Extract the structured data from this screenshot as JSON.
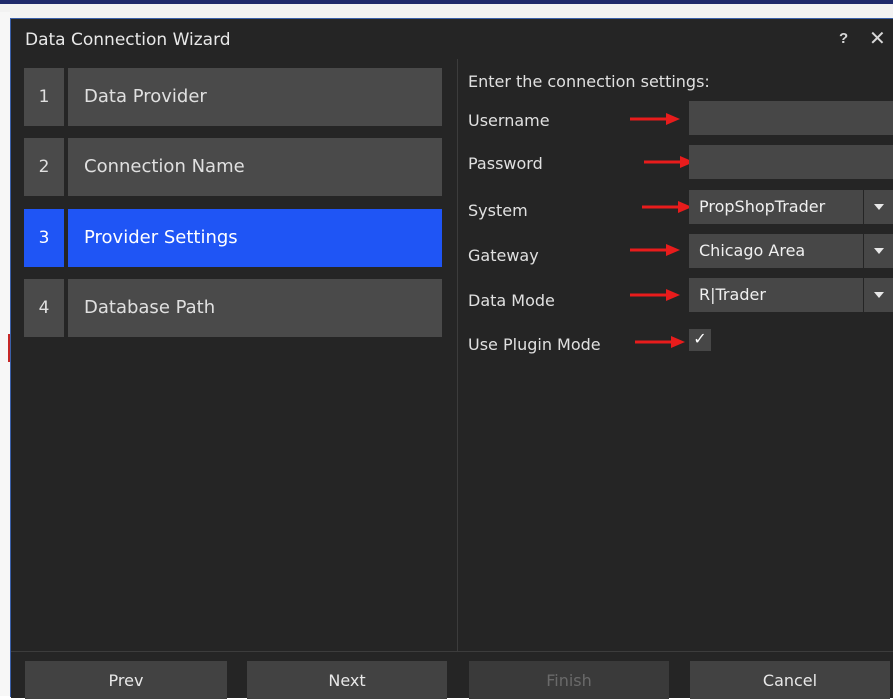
{
  "window": {
    "title": "Data Connection Wizard",
    "help_label": "?",
    "close_label": "✕"
  },
  "steps": [
    {
      "number": "1",
      "label": "Data Provider",
      "active": false
    },
    {
      "number": "2",
      "label": "Connection Name",
      "active": false
    },
    {
      "number": "3",
      "label": "Provider Settings",
      "active": true
    },
    {
      "number": "4",
      "label": "Database Path",
      "active": false
    }
  ],
  "settings": {
    "heading": "Enter the connection settings:",
    "username": {
      "label": "Username",
      "value": ""
    },
    "password": {
      "label": "Password",
      "value": ""
    },
    "system": {
      "label": "System",
      "value": "PropShopTrader"
    },
    "gateway": {
      "label": "Gateway",
      "value": "Chicago Area"
    },
    "data_mode": {
      "label": "Data Mode",
      "value": "R|Trader"
    },
    "plugin_mode": {
      "label": "Use Plugin Mode",
      "checked": true,
      "mark": "✓"
    }
  },
  "footer": {
    "prev": "Prev",
    "next": "Next",
    "finish": "Finish",
    "cancel": "Cancel"
  },
  "colors": {
    "accent": "#1f55f5",
    "arrow": "#e81c1c",
    "dialog_bg": "#252525",
    "panel": "#4a4a4a"
  },
  "icons": {
    "arrow": "red-arrow-icon",
    "dropdown": "chevron-down-icon",
    "check": "checkmark-icon"
  }
}
